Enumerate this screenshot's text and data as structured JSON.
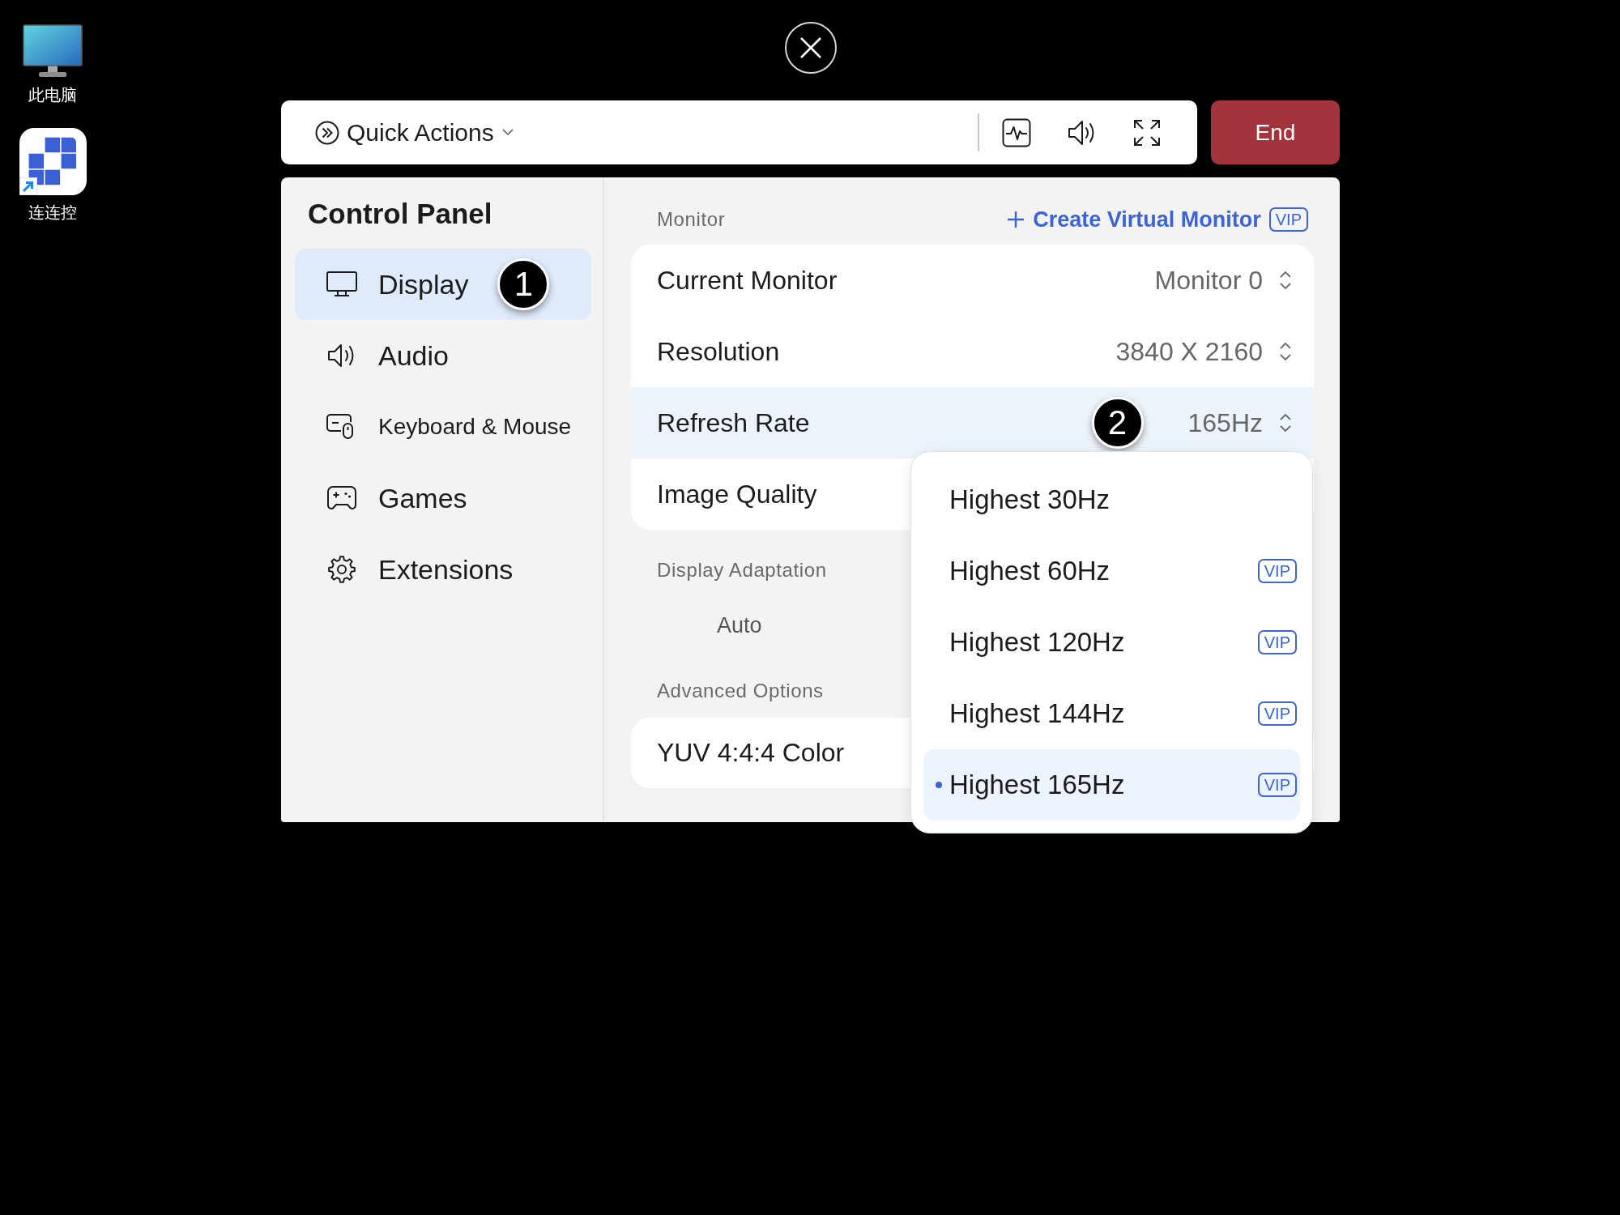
{
  "desktop": {
    "icons": [
      {
        "label": "此电脑",
        "kind": "computer",
        "shortcut": false
      },
      {
        "label": "连连控",
        "kind": "app",
        "shortcut": true
      }
    ]
  },
  "toolbar": {
    "quick_actions": "Quick Actions",
    "end_button": "End"
  },
  "sidebar": {
    "title": "Control Panel",
    "items": [
      {
        "label": "Display",
        "kind": "display",
        "selected": true,
        "callout": "1"
      },
      {
        "label": "Audio",
        "kind": "audio",
        "selected": false
      },
      {
        "label": "Keyboard & Mouse",
        "kind": "keyboard_mouse",
        "selected": false
      },
      {
        "label": "Games",
        "kind": "games",
        "selected": false
      },
      {
        "label": "Extensions",
        "kind": "extensions",
        "selected": false
      }
    ]
  },
  "monitor": {
    "heading": "Monitor",
    "create_link": {
      "label": "Create Virtual Monitor",
      "badge": "VIP"
    },
    "rows": [
      {
        "label": "Current Monitor",
        "value": "Monitor 0",
        "expanded": false
      },
      {
        "label": "Resolution",
        "value": "3840 X 2160",
        "expanded": false
      },
      {
        "label": "Refresh Rate",
        "value": "165Hz",
        "expanded": true,
        "callout": "2",
        "options": [
          {
            "label": "Highest 30Hz",
            "selected": false
          },
          {
            "label": "Highest 60Hz",
            "badge": "VIP",
            "selected": false
          },
          {
            "label": "Highest 120Hz",
            "badge": "VIP",
            "selected": false
          },
          {
            "label": "Highest 144Hz",
            "badge": "VIP",
            "selected": false
          },
          {
            "label": "Highest 165Hz",
            "badge": "VIP",
            "selected": true
          }
        ]
      },
      {
        "label": "Image Quality",
        "expanded": false
      }
    ]
  },
  "display_adaptation": {
    "heading": "Display Adaptation",
    "value": "Auto"
  },
  "advanced_options": {
    "heading": "Advanced Options",
    "rows": [
      {
        "label": "YUV 4:4:4 Color"
      }
    ]
  }
}
